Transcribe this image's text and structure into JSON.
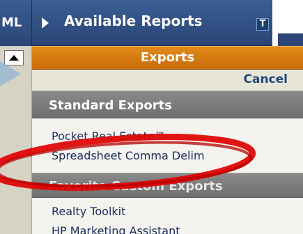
{
  "sidebar": {
    "ml_label": "ML",
    "scroll_up_icon": "chevron-up-icon"
  },
  "header": {
    "title": "Available Reports",
    "play_icon": "play-triangle-icon",
    "t_icon_label": "T"
  },
  "exports_panel": {
    "title": "Exports",
    "cancel_label": "Cancel",
    "standard_section": {
      "title": "Standard Exports",
      "items": [
        {
          "label": "Pocket Real Estate™"
        },
        {
          "label": "Spreadsheet Comma Delim"
        }
      ]
    },
    "favorite_section": {
      "title": "Favorite Custom Exports",
      "items": [
        {
          "label": "Realty Toolkit"
        },
        {
          "label": "HP Marketing Assistant"
        }
      ]
    }
  },
  "colors": {
    "header_blue": "#2b4677",
    "exports_orange": "#d97a10",
    "section_gray": "#7c7c7c",
    "link_blue": "#1a2b5f",
    "annotation_red": "#d40000"
  }
}
